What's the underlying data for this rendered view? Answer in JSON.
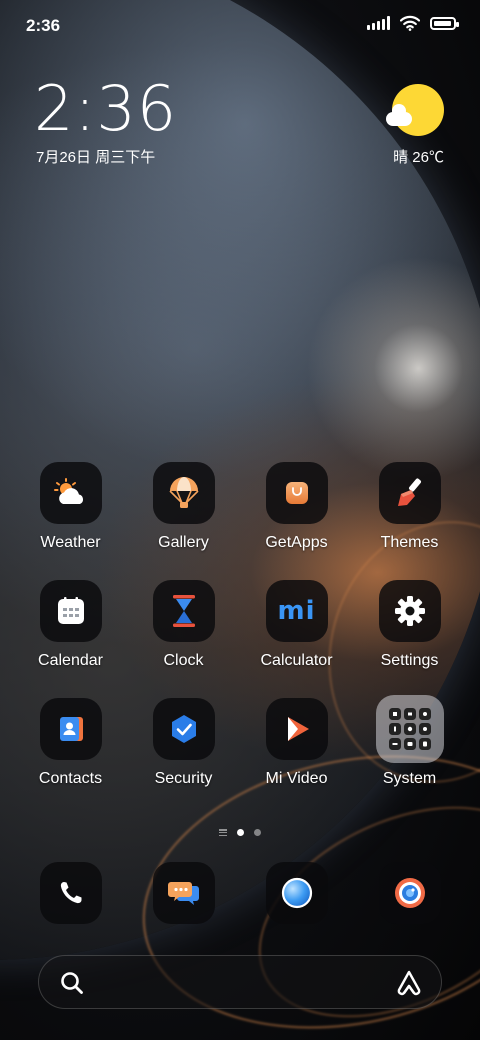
{
  "status_bar": {
    "time": "2:36",
    "icons": [
      "signal-icon",
      "wifi-icon",
      "battery-icon"
    ],
    "battery_level": 0.95
  },
  "clock_widget": {
    "time": "2:36",
    "date": "7月26日 周三下午"
  },
  "weather_widget": {
    "condition_icon": "sun-cloud-icon",
    "text": "晴 26℃"
  },
  "apps": [
    [
      {
        "label": "Weather",
        "icon": "weather-icon"
      },
      {
        "label": "Gallery",
        "icon": "gallery-icon"
      },
      {
        "label": "GetApps",
        "icon": "getapps-icon"
      },
      {
        "label": "Themes",
        "icon": "themes-icon"
      }
    ],
    [
      {
        "label": "Calendar",
        "icon": "calendar-icon"
      },
      {
        "label": "Clock",
        "icon": "clock-icon"
      },
      {
        "label": "Calculator",
        "icon": "calculator-icon"
      },
      {
        "label": "Settings",
        "icon": "settings-icon"
      }
    ],
    [
      {
        "label": "Contacts",
        "icon": "contacts-icon"
      },
      {
        "label": "Security",
        "icon": "security-icon"
      },
      {
        "label": "Mi Video",
        "icon": "mi-video-icon"
      },
      {
        "label": "System",
        "icon": "system-folder-icon"
      }
    ]
  ],
  "calculator_glyph": "mi",
  "page_indicator": {
    "pages": 2,
    "active": 1
  },
  "dock": [
    {
      "icon": "phone-icon"
    },
    {
      "icon": "messages-icon"
    },
    {
      "icon": "browser-icon"
    },
    {
      "icon": "camera-icon"
    }
  ],
  "search_bar": {
    "left_icon": "search-icon",
    "right_icon": "assistant-icon"
  },
  "colors": {
    "accent_yellow": "#fdd835",
    "security_blue": "#2a7de8",
    "getapps_orange": "#ee8e4a",
    "themes_red": "#e8523d"
  }
}
